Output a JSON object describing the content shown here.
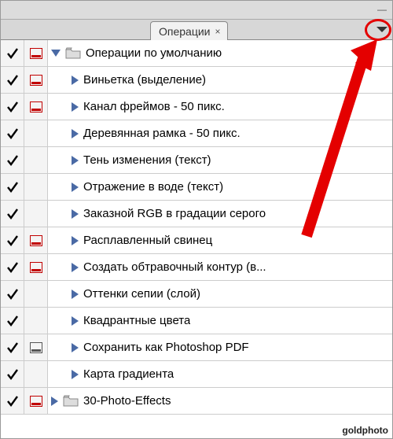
{
  "tab": {
    "label": "Операции"
  },
  "sets": [
    {
      "expanded": true,
      "checked": true,
      "dialog": "red",
      "folder": true,
      "label": "Операции по умолчанию",
      "items": [
        {
          "checked": true,
          "dialog": "red",
          "label": "Виньетка (выделение)"
        },
        {
          "checked": true,
          "dialog": "red",
          "label": "Канал фреймов - 50 пикс."
        },
        {
          "checked": true,
          "dialog": "none",
          "label": "Деревянная рамка - 50 пикс."
        },
        {
          "checked": true,
          "dialog": "none",
          "label": "Тень изменения (текст)"
        },
        {
          "checked": true,
          "dialog": "none",
          "label": "Отражение в воде (текст)"
        },
        {
          "checked": true,
          "dialog": "none",
          "label": "Заказной RGB в градации серого"
        },
        {
          "checked": true,
          "dialog": "red",
          "label": "Расплавленный свинец"
        },
        {
          "checked": true,
          "dialog": "red",
          "label": "Создать обтравочный контур (в..."
        },
        {
          "checked": true,
          "dialog": "none",
          "label": "Оттенки сепии (слой)"
        },
        {
          "checked": true,
          "dialog": "none",
          "label": "Квадрантные цвета"
        },
        {
          "checked": true,
          "dialog": "gray",
          "label": "Сохранить как Photoshop PDF"
        },
        {
          "checked": true,
          "dialog": "none",
          "label": "Карта градиента"
        }
      ]
    },
    {
      "expanded": false,
      "checked": true,
      "dialog": "red",
      "folder": true,
      "label": "30-Photo-Effects",
      "items": []
    }
  ],
  "watermark": "goldphoto"
}
